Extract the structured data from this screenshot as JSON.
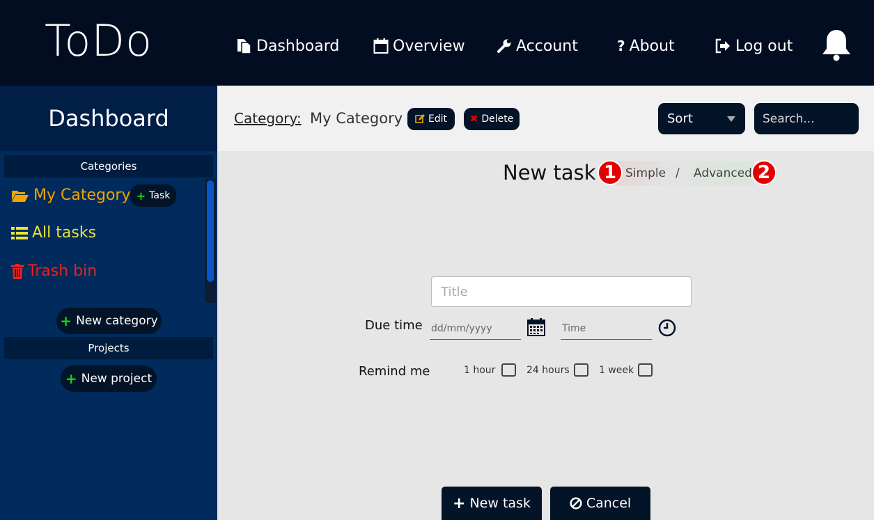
{
  "app": {
    "logo": "ToDo"
  },
  "nav": {
    "dashboard": "Dashboard",
    "overview": "Overview",
    "account": "Account",
    "about": "About",
    "logout": "Log out",
    "about_icon": "?"
  },
  "sidebar": {
    "title": "Dashboard",
    "categories_header": "Categories",
    "items": [
      {
        "label": "My Category",
        "icon": "folder-open-icon",
        "color": "#f0a500"
      },
      {
        "label": "All tasks",
        "icon": "list-icon",
        "color": "#e8e337"
      },
      {
        "label": "Trash bin",
        "icon": "trash-icon",
        "color": "#e42424"
      }
    ],
    "task_button": "Task",
    "new_category": "New category",
    "projects_header": "Projects",
    "new_project": "New project"
  },
  "content_header": {
    "category_label": "Category:",
    "category_name": "My Category",
    "edit": "Edit",
    "delete": "Delete",
    "sort": "Sort",
    "search_placeholder": "Search..."
  },
  "form": {
    "heading": "New task",
    "mode_simple": "Simple",
    "mode_separator": "/",
    "mode_advanced": "Advanced",
    "badge_1": "1",
    "badge_2": "2",
    "title_placeholder": "Title",
    "due_time_label": "Due time",
    "date_placeholder": "dd/mm/yyyy",
    "time_placeholder": "Time",
    "remind_label": "Remind me",
    "remind_options": [
      "1 hour",
      "24 hours",
      "1 week"
    ],
    "submit": "New task",
    "cancel": "Cancel"
  },
  "colors": {
    "header_bg": "#020d21",
    "sidebar_bg": "#002b5c",
    "button_bg": "#031328",
    "plus_green": "#18d318",
    "badge_red": "#e30000"
  }
}
